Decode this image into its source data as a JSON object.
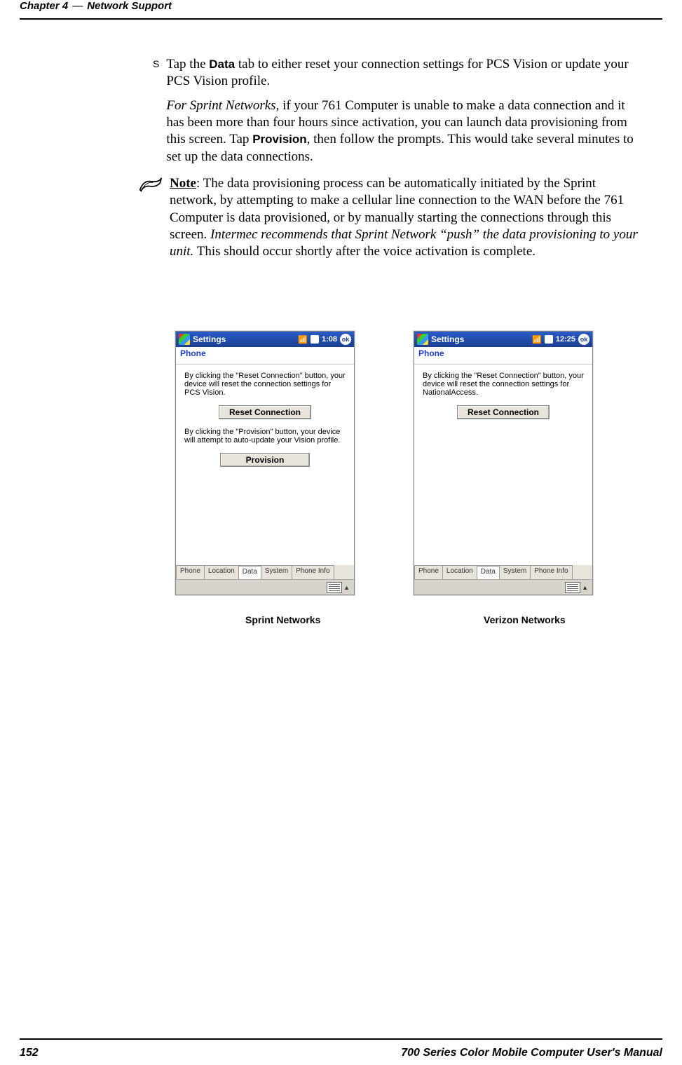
{
  "header": {
    "chapter": "Chapter 4",
    "section": "Network Support"
  },
  "footer": {
    "page": "152",
    "title": "700 Series Color Mobile Computer User's Manual"
  },
  "bullet": {
    "t1a": "Tap the ",
    "t1b": "Data",
    "t1c": " tab to either reset your connection settings for PCS Vision or update your PCS Vision profile.",
    "t2a": "For Sprint Networks,",
    "t2b": " if your 761 Computer is unable to make a data connection and it has been more than four hours since activation, you can launch data provisioning from this screen. Tap ",
    "t2c": "Provision",
    "t2d": ", then follow the prompts. This would take several minutes to set up the data connections."
  },
  "note": {
    "n1a": "Note",
    "n1b": ": The data provisioning process can be automatically initiated by the Sprint network, by attempting to make a cellular line connection to the WAN before the 761 Computer is data provisioned, or by manually starting the connections through this screen. ",
    "n1c": "Intermec recommends that Sprint Network “push” the data provisioning to your unit.",
    "n1d": " This should occur shortly after the voice activation is complete."
  },
  "screens": {
    "settings": "Settings",
    "ok": "ok",
    "phone": "Phone",
    "tabs": {
      "phone": "Phone",
      "location": "Location",
      "data": "Data",
      "system": "System",
      "info": "Phone Info"
    },
    "sprint": {
      "time": "1:08",
      "text1": "By clicking the \"Reset Connection\" button, your device will reset the connection settings for PCS Vision.",
      "btn1": "Reset Connection",
      "text2": "By clicking the \"Provision\" button, your device will attempt to auto-update your Vision profile.",
      "btn2": "Provision"
    },
    "verizon": {
      "time": "12:25",
      "text1": "By clicking the \"Reset Connection\" button, your device will reset the connection settings for NationalAccess.",
      "btn1": "Reset Connection"
    }
  },
  "captions": {
    "sprint": "Sprint Networks",
    "verizon": "Verizon Networks"
  }
}
